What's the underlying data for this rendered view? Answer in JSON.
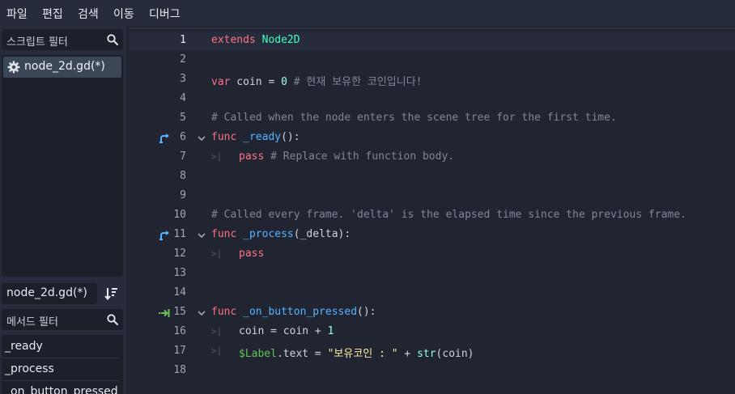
{
  "menu": [
    "파일",
    "편집",
    "검색",
    "이동",
    "디버그"
  ],
  "scripts_panel": {
    "filter_placeholder": "스크립트 필터",
    "items": [
      {
        "label": "node_2d.gd(*)"
      }
    ]
  },
  "current_script": "node_2d.gd(*)",
  "methods_panel": {
    "filter_placeholder": "메서드 필터",
    "items": [
      "_ready",
      "_process",
      "_on_button_pressed"
    ]
  },
  "editor": {
    "line_numbers": [
      "1",
      "2",
      "3",
      "4",
      "5",
      "6",
      "7",
      "8",
      "9",
      "10",
      "11",
      "12",
      "13",
      "14",
      "15",
      "16",
      "17",
      "18"
    ],
    "code": {
      "l1_kw": "extends",
      "l1_type": "Node2D",
      "l3_kw": "var",
      "l3_name": " coin = ",
      "l3_num": "0",
      "l3_comment": " # 현재 보유한 코인입니다!",
      "l5_comment": "# Called when the node enters the scene tree for the first time.",
      "l6_kw": "func",
      "l6_fn": "_ready",
      "l6_rest": "():",
      "l7_kw": "pass",
      "l7_comment": " # Replace with function body.",
      "l10_comment": "# Called every frame. 'delta' is the elapsed time since the previous frame.",
      "l11_kw": "func",
      "l11_fn": "_process",
      "l11_rest": "(_delta):",
      "l12_kw": "pass",
      "l15_kw": "func",
      "l15_fn": "_on_button_pressed",
      "l15_rest": "():",
      "l16_a": "coin = coin + ",
      "l16_num": "1",
      "l17_node": "$Label",
      "l17_a": ".text = ",
      "l17_str": "\"보유코인 : \"",
      "l17_b": " + ",
      "l17_bi": "str",
      "l17_c": "(coin)"
    }
  },
  "colors": {
    "keyword": "#ff7085",
    "type": "#42ffc2",
    "number": "#a1ffe0",
    "comment": "#7e8796",
    "function": "#57b3ff",
    "string": "#ffeda1",
    "node_path": "#63c259",
    "override_icon": "#57b3ff",
    "signal_icon": "#63c259"
  }
}
